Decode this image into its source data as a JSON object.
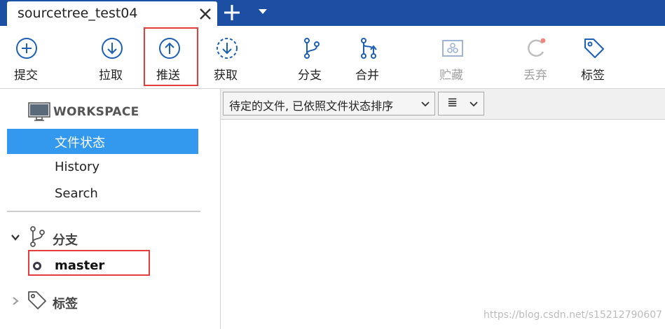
{
  "tab": {
    "title": "sourcetree_test04"
  },
  "toolbar": {
    "items": [
      {
        "label": "提交",
        "icon": "plus-circle-icon",
        "enabled": true
      },
      {
        "label": "拉取",
        "icon": "arrow-down-circle-icon",
        "enabled": true
      },
      {
        "label": "推送",
        "icon": "arrow-up-circle-icon",
        "enabled": true
      },
      {
        "label": "获取",
        "icon": "dashed-arrow-down-circle-icon",
        "enabled": true
      },
      {
        "label": "分支",
        "icon": "branch-icon",
        "enabled": true
      },
      {
        "label": "合并",
        "icon": "merge-icon",
        "enabled": true
      },
      {
        "label": "贮藏",
        "icon": "stash-icon",
        "enabled": false
      },
      {
        "label": "丢弃",
        "icon": "discard-icon",
        "enabled": false
      },
      {
        "label": "标签",
        "icon": "tag-icon",
        "enabled": true
      }
    ]
  },
  "sidebar": {
    "workspace_label": "WORKSPACE",
    "items": [
      {
        "label": "文件状态",
        "selected": true
      },
      {
        "label": "History",
        "selected": false
      },
      {
        "label": "Search",
        "selected": false
      }
    ],
    "branches_label": "分支",
    "branches": [
      {
        "name": "master",
        "current": true
      }
    ],
    "tags_label": "标签"
  },
  "main": {
    "file_filter": "待定的文件, 已依照文件状态排序",
    "view_mode_icon": "list-icon",
    "view_mode_glyph": "≣"
  },
  "watermark": "https://blog.csdn.net/s15212790607",
  "colors": {
    "titlebar": "#1c4ea3",
    "accent": "#1c5fb8",
    "selected": "#3399ee",
    "highlight_border": "#e53c3c",
    "disabled": "#a0a0a0"
  }
}
